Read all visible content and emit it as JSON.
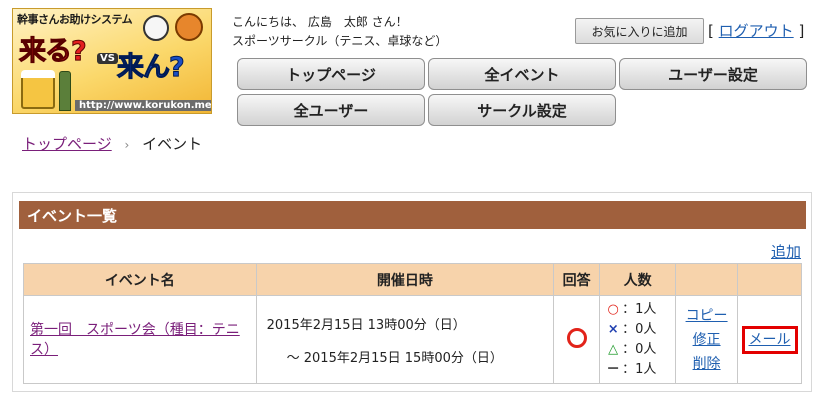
{
  "logo": {
    "tagline": "幹事さんお助けシステム",
    "main_text_1": "来る?",
    "vs": "VS",
    "main_text_2": "来ん?",
    "url": "http://www.korukon.me"
  },
  "header": {
    "greeting": "こんにちは、 広島　太郎 さん！",
    "circle": "スポーツサークル（テニス、卓球など）",
    "favorite_label": "お気に入りに追加",
    "logout_open": "[",
    "logout_label": "ログアウト",
    "logout_close": "]"
  },
  "nav": {
    "top": "トップページ",
    "all_events": "全イベント",
    "user_settings": "ユーザー設定",
    "all_users": "全ユーザー",
    "circle_settings": "サークル設定"
  },
  "breadcrumb": {
    "home": "トップページ",
    "sep": "›",
    "current": "イベント"
  },
  "panel": {
    "title": "イベント一覧",
    "add_label": "追加",
    "columns": {
      "name": "イベント名",
      "date": "開催日時",
      "answer": "回答",
      "count": "人数"
    },
    "rows": [
      {
        "name": "第一回　スポーツ会（種目：テニス）",
        "date_start": "2015年2月15日 13時00分（日）",
        "date_end": "～ 2015年2月15日 15時00分（日）",
        "counts": {
          "yes_sym": "○",
          "yes": "：1人",
          "no_sym": "×",
          "no": "：0人",
          "maybe_sym": "△",
          "maybe": "：0人",
          "none_sym": "－",
          "none": "：1人"
        },
        "copy": "コピー",
        "edit": "修正",
        "delete": "削除",
        "mail": "メール"
      }
    ]
  },
  "colors": {
    "panel_header": "#a0603d",
    "table_header": "#f7d3ab",
    "link_purple": "#7a1f7a",
    "link_blue": "#1f5fb0",
    "answer_circle": "#e2231a",
    "mail_highlight": "#e30000"
  }
}
